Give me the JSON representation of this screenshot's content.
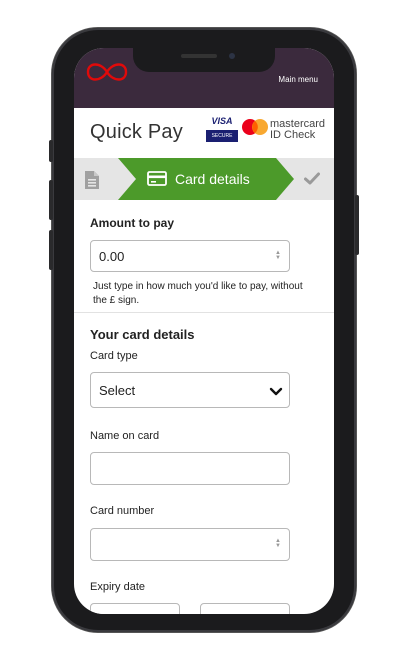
{
  "header": {
    "main_menu": "Main menu"
  },
  "page": {
    "title": "Quick Pay"
  },
  "badges": {
    "visa_top": "VISA",
    "visa_bottom": "SECURE",
    "mastercard_line1": "mastercard",
    "mastercard_line2": "ID Check"
  },
  "steps": {
    "active_label": "Card details"
  },
  "amount": {
    "label": "Amount to pay",
    "value": "0.00",
    "hint": "Just type in how much you'd like to pay, without the £ sign."
  },
  "card": {
    "section_title": "Your card details",
    "type_label": "Card type",
    "type_value": "Select",
    "name_label": "Name on card",
    "number_label": "Card number",
    "expiry_label": "Expiry date"
  },
  "colors": {
    "header_bg": "#3b2a3d",
    "step_green": "#4c9a2a",
    "brand_red": "#e10a0a"
  }
}
